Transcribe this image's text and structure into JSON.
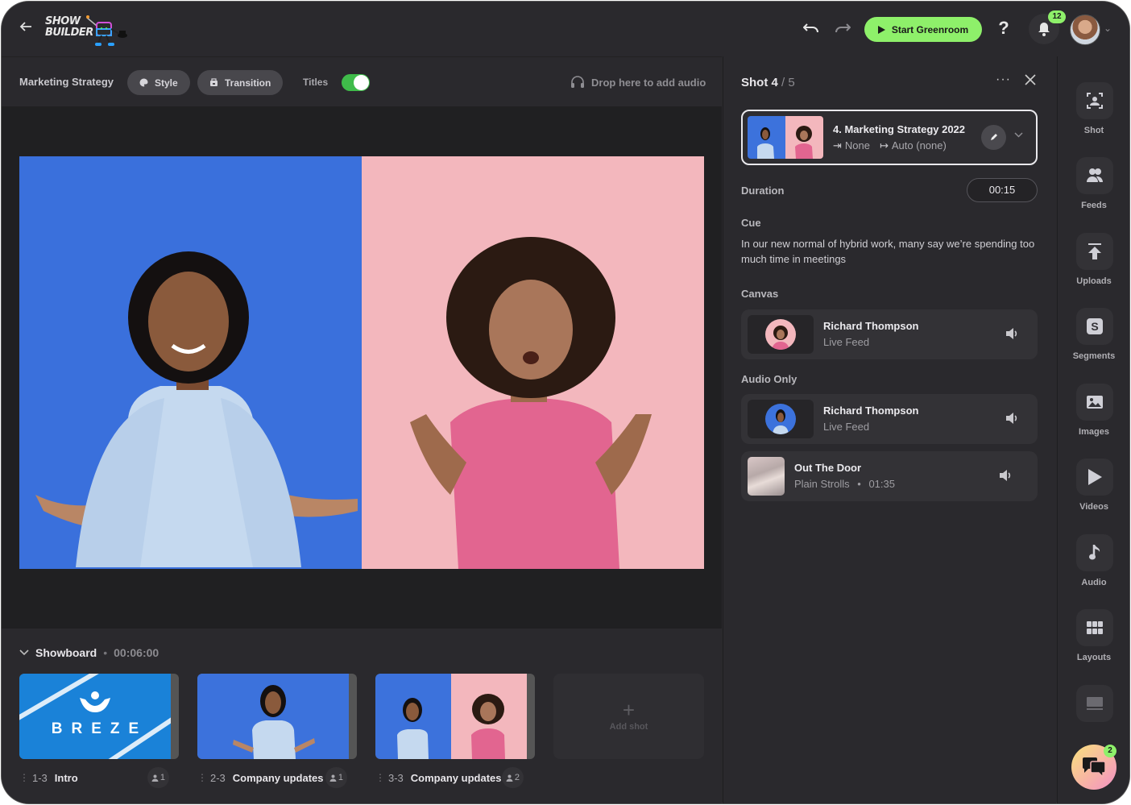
{
  "app": {
    "logo_text_line1": "SHOW",
    "logo_text_line2": "BUILDER"
  },
  "topbar": {
    "back_icon": "arrow-left-icon",
    "undo_icon": "undo-icon",
    "redo_icon": "redo-icon",
    "greenroom_label": "Start Greenroom",
    "help_label": "?",
    "notification_count": "12",
    "accent_color": "#8ef06a"
  },
  "toolbar": {
    "project_title": "Marketing Strategy",
    "style_label": "Style",
    "transition_label": "Transition",
    "titles_label": "Titles",
    "titles_enabled": true,
    "audio_drop_label": "Drop here to add audio"
  },
  "canvas": {
    "left_bg": "#3a70dc",
    "right_bg": "#f3b7bd"
  },
  "showboard": {
    "title": "Showboard",
    "separator": "•",
    "duration": "00:06:00",
    "shots": [
      {
        "num": "1-3",
        "name": "Intro",
        "feeds": "1",
        "thumb_text": "BREZE"
      },
      {
        "num": "2-3",
        "name": "Company updates",
        "feeds": "1"
      },
      {
        "num": "3-3",
        "name": "Company updates",
        "feeds": "2"
      }
    ],
    "add_shot_label": "Add shot",
    "add_shot_icon": "+"
  },
  "detail": {
    "shot_label": "Shot 4",
    "shot_total": "/ 5",
    "more_icon": "···",
    "close_icon": "✕",
    "selected_shot": {
      "title": "4. Marketing Strategy 2022",
      "transition_in": "None",
      "transition_out": "Auto (none)"
    },
    "duration_label": "Duration",
    "duration_value": "00:15",
    "cue_label": "Cue",
    "cue_text": "In our new normal of hybrid work, many say we’re spending too much time in meetings",
    "canvas_label": "Canvas",
    "canvas_feeds": [
      {
        "name": "Richard Thompson",
        "sub": "Live Feed"
      }
    ],
    "audio_only_label": "Audio Only",
    "audio_feeds": [
      {
        "name": "Richard Thompson",
        "sub": "Live Feed"
      }
    ],
    "music": {
      "title": "Out The Door",
      "artist": "Plain Strolls",
      "separator": "•",
      "length": "01:35"
    }
  },
  "rail": {
    "items": [
      {
        "label": "Shot",
        "icon": "shot-frame-icon"
      },
      {
        "label": "Feeds",
        "icon": "people-icon"
      },
      {
        "label": "Uploads",
        "icon": "upload-icon"
      },
      {
        "label": "Segments",
        "icon": "segments-s-icon"
      },
      {
        "label": "Images",
        "icon": "image-icon"
      },
      {
        "label": "Videos",
        "icon": "play-icon"
      },
      {
        "label": "Audio",
        "icon": "music-note-icon"
      },
      {
        "label": "Layouts",
        "icon": "grid-icon"
      },
      {
        "label": "",
        "icon": "screen-icon"
      }
    ],
    "chat_badge": "2"
  }
}
